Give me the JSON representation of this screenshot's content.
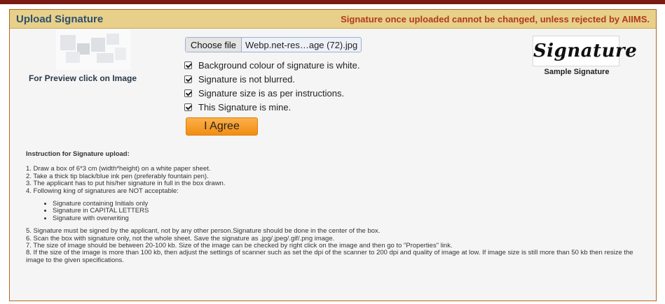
{
  "header": {
    "title": "Upload Signature",
    "note": "Signature once uploaded cannot be changed, unless rejected by AIIMS."
  },
  "preview": {
    "label": "For Preview click on Image"
  },
  "file_input": {
    "button_label": "Choose file",
    "file_name": "Webp.net-res…age (72).jpg"
  },
  "checks": [
    {
      "label": "Background colour of signature is white.",
      "checked": true
    },
    {
      "label": "Signature is not blurred.",
      "checked": true
    },
    {
      "label": "Signature size is as per instructions.",
      "checked": true
    },
    {
      "label": "This Signature is mine.",
      "checked": true
    }
  ],
  "agree_button": "I Agree",
  "sample": {
    "image_text": "Signature",
    "label": "Sample Signature"
  },
  "instructions": {
    "title": "Instruction for Signature upload:",
    "lines_a": [
      "1. Draw a box of 6*3 cm (width*height) on a white paper sheet.",
      "2. Take a thick tip black/blue ink pen (preferably fountain pen).",
      "3. The applicant has to put his/her signature in full in the box drawn.",
      "4. Following king of signatures are NOT acceptable:"
    ],
    "bullets": [
      "Signature containing Initials only",
      "Signature in CAPITAL LETTERS",
      "Signature with overwriting"
    ],
    "lines_b": [
      "5. Signature must be signed by the applicant, not by any other person.Signature should be done in the center of the box.",
      "6. Scan the box with signature only, not the whole sheet. Save the signature as .jpg/.jpeg/.gif/.png image.",
      "7. The size of image should be between 20-100 kb. Size of the image can be checked by right click on the image and then go to \"Properties\" link.",
      "8. If the size of the image is more than 100 kb, then adjust the settings of scanner such as set the dpi of the scanner to 200 dpi and quality of image at low. If image size is still more than 50 kb then resize the image to the given specifications."
    ]
  }
}
